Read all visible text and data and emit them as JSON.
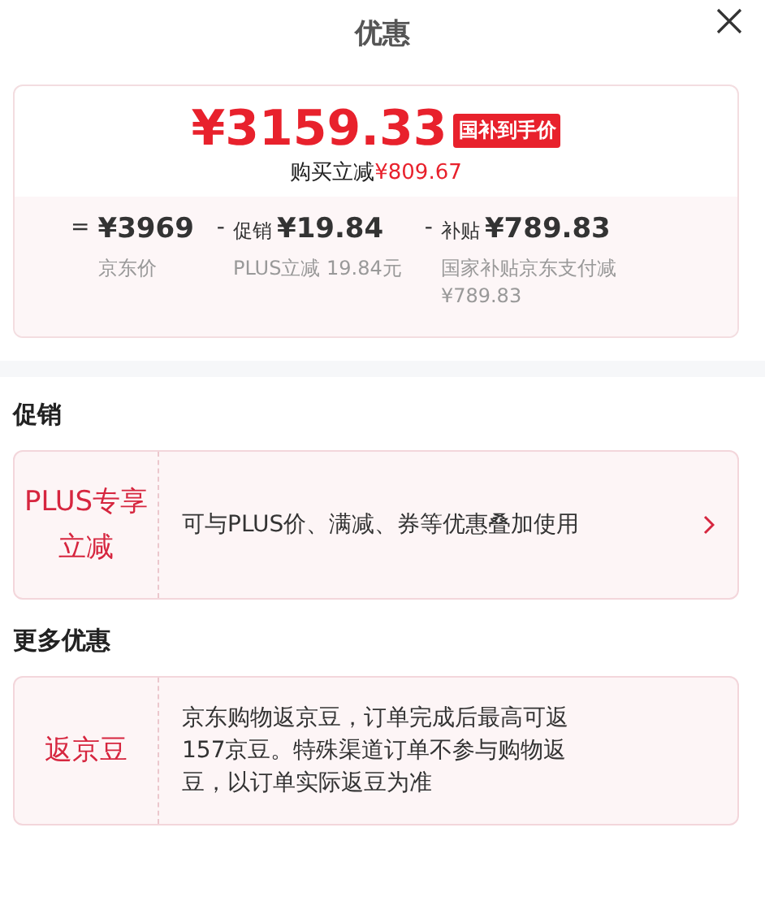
{
  "header": {
    "title": "优惠"
  },
  "price_card": {
    "currency": "¥",
    "price": "3159.33",
    "badge": "国补到手价",
    "saving_label": "购买立减",
    "saving_amount": "¥809.67",
    "breakdown": [
      {
        "operator": "=",
        "amount": "¥3969",
        "note": "京东价"
      },
      {
        "operator": "-",
        "tag": "促销",
        "amount": "¥19.84",
        "note": "PLUS立减 19.84元"
      },
      {
        "operator": "-",
        "tag": "补贴",
        "amount": "¥789.83",
        "note": "国家补贴京东支付减¥789.83"
      }
    ]
  },
  "sections": [
    {
      "heading": "促销",
      "offers": [
        {
          "label": "PLUS专享立减",
          "text": "可与PLUS价、满减、券等优惠叠加使用",
          "arrow": true
        }
      ]
    },
    {
      "heading": "更多优惠",
      "offers": [
        {
          "label": "返京豆",
          "text": "京东购物返京豆，订单完成后最高可返157京豆。特殊渠道订单不参与购物返豆，以订单实际返豆为准",
          "arrow": false
        }
      ]
    }
  ]
}
